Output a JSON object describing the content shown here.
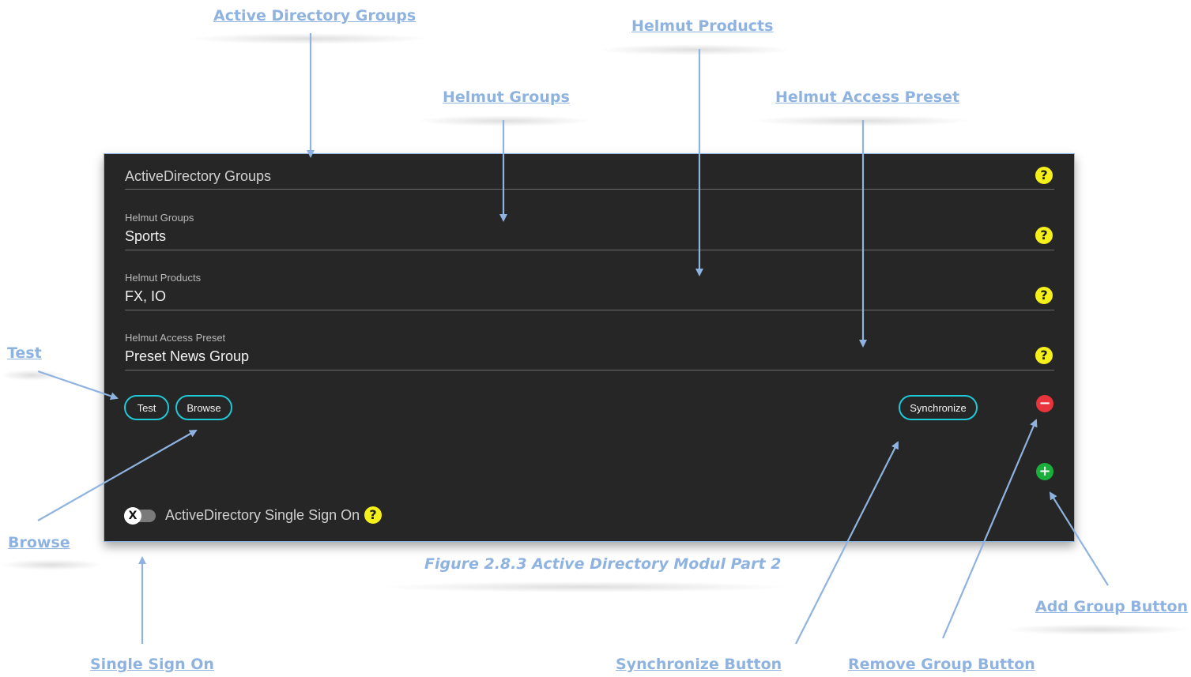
{
  "callouts": {
    "active_directory_groups": "Active Directory Groups",
    "helmut_products": "Helmut Products",
    "helmut_groups": "Helmut Groups",
    "helmut_access_preset": "Helmut Access Preset",
    "test": "Test",
    "browse": "Browse",
    "single_sign_on": "Single Sign On",
    "synchronize_button": "Synchronize Button",
    "remove_group_button": "Remove Group Button",
    "add_group_button": "Add Group Button"
  },
  "panel": {
    "section_title": "ActiveDirectory Groups",
    "fields": [
      {
        "label": "Helmut Groups",
        "value": "Sports"
      },
      {
        "label": "Helmut Products",
        "value": "FX, IO"
      },
      {
        "label": "Helmut Access Preset",
        "value": "Preset News Group"
      }
    ],
    "buttons": {
      "test": "Test",
      "browse": "Browse",
      "synchronize": "Synchronize"
    },
    "help_glyph": "?",
    "remove_glyph": "−",
    "add_glyph": "+",
    "toggle": {
      "knob_glyph": "X",
      "label": "ActiveDirectory Single Sign On",
      "enabled": false
    }
  },
  "caption": "Figure 2.8.3 Active Directory Modul  Part 2",
  "colors": {
    "panel_bg": "#262626",
    "accent_border": "#1fc9d8",
    "help": "#f5ef1a",
    "remove": "#e8343b",
    "add": "#1aae3b",
    "callout": "#8fb3e0"
  }
}
